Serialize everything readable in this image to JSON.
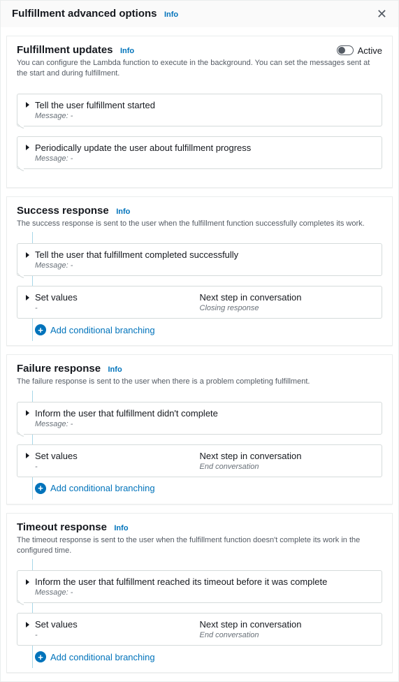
{
  "header": {
    "title": "Fulfillment advanced options",
    "info": "Info"
  },
  "sections": {
    "updates": {
      "title": "Fulfillment updates",
      "info": "Info",
      "toggle_label": "Active",
      "desc": "You can configure the Lambda function to execute in the background. You can set the messages sent at the start and during fulfillment.",
      "cards": {
        "started": {
          "title": "Tell the user fulfillment started",
          "sub": "Message: -"
        },
        "progress": {
          "title": "Periodically update the user about fulfillment progress",
          "sub": "Message: -"
        }
      }
    },
    "success": {
      "title": "Success response",
      "info": "Info",
      "desc": "The success response is sent to the user when the fulfillment function successfully completes its work.",
      "msg": {
        "title": "Tell the user that fulfillment completed successfully",
        "sub": "Message: -"
      },
      "setvalues": {
        "title": "Set values",
        "sub": "-"
      },
      "next": {
        "title": "Next step in conversation",
        "sub": "Closing response"
      },
      "add": "Add conditional branching"
    },
    "failure": {
      "title": "Failure response",
      "info": "Info",
      "desc": "The failure response is sent to the user when there is a problem completing fulfillment.",
      "msg": {
        "title": "Inform the user that fulfillment didn't complete",
        "sub": "Message: -"
      },
      "setvalues": {
        "title": "Set values",
        "sub": "-"
      },
      "next": {
        "title": "Next step in conversation",
        "sub": "End conversation"
      },
      "add": "Add conditional branching"
    },
    "timeout": {
      "title": "Timeout response",
      "info": "Info",
      "desc": "The timeout response is sent to the user when the fulfillment function doesn't complete its work in the configured time.",
      "msg": {
        "title": "Inform the user that fulfillment reached its timeout before it was complete",
        "sub": "Message: -"
      },
      "setvalues": {
        "title": "Set values",
        "sub": "-"
      },
      "next": {
        "title": "Next step in conversation",
        "sub": "End conversation"
      },
      "add": "Add conditional branching"
    }
  }
}
